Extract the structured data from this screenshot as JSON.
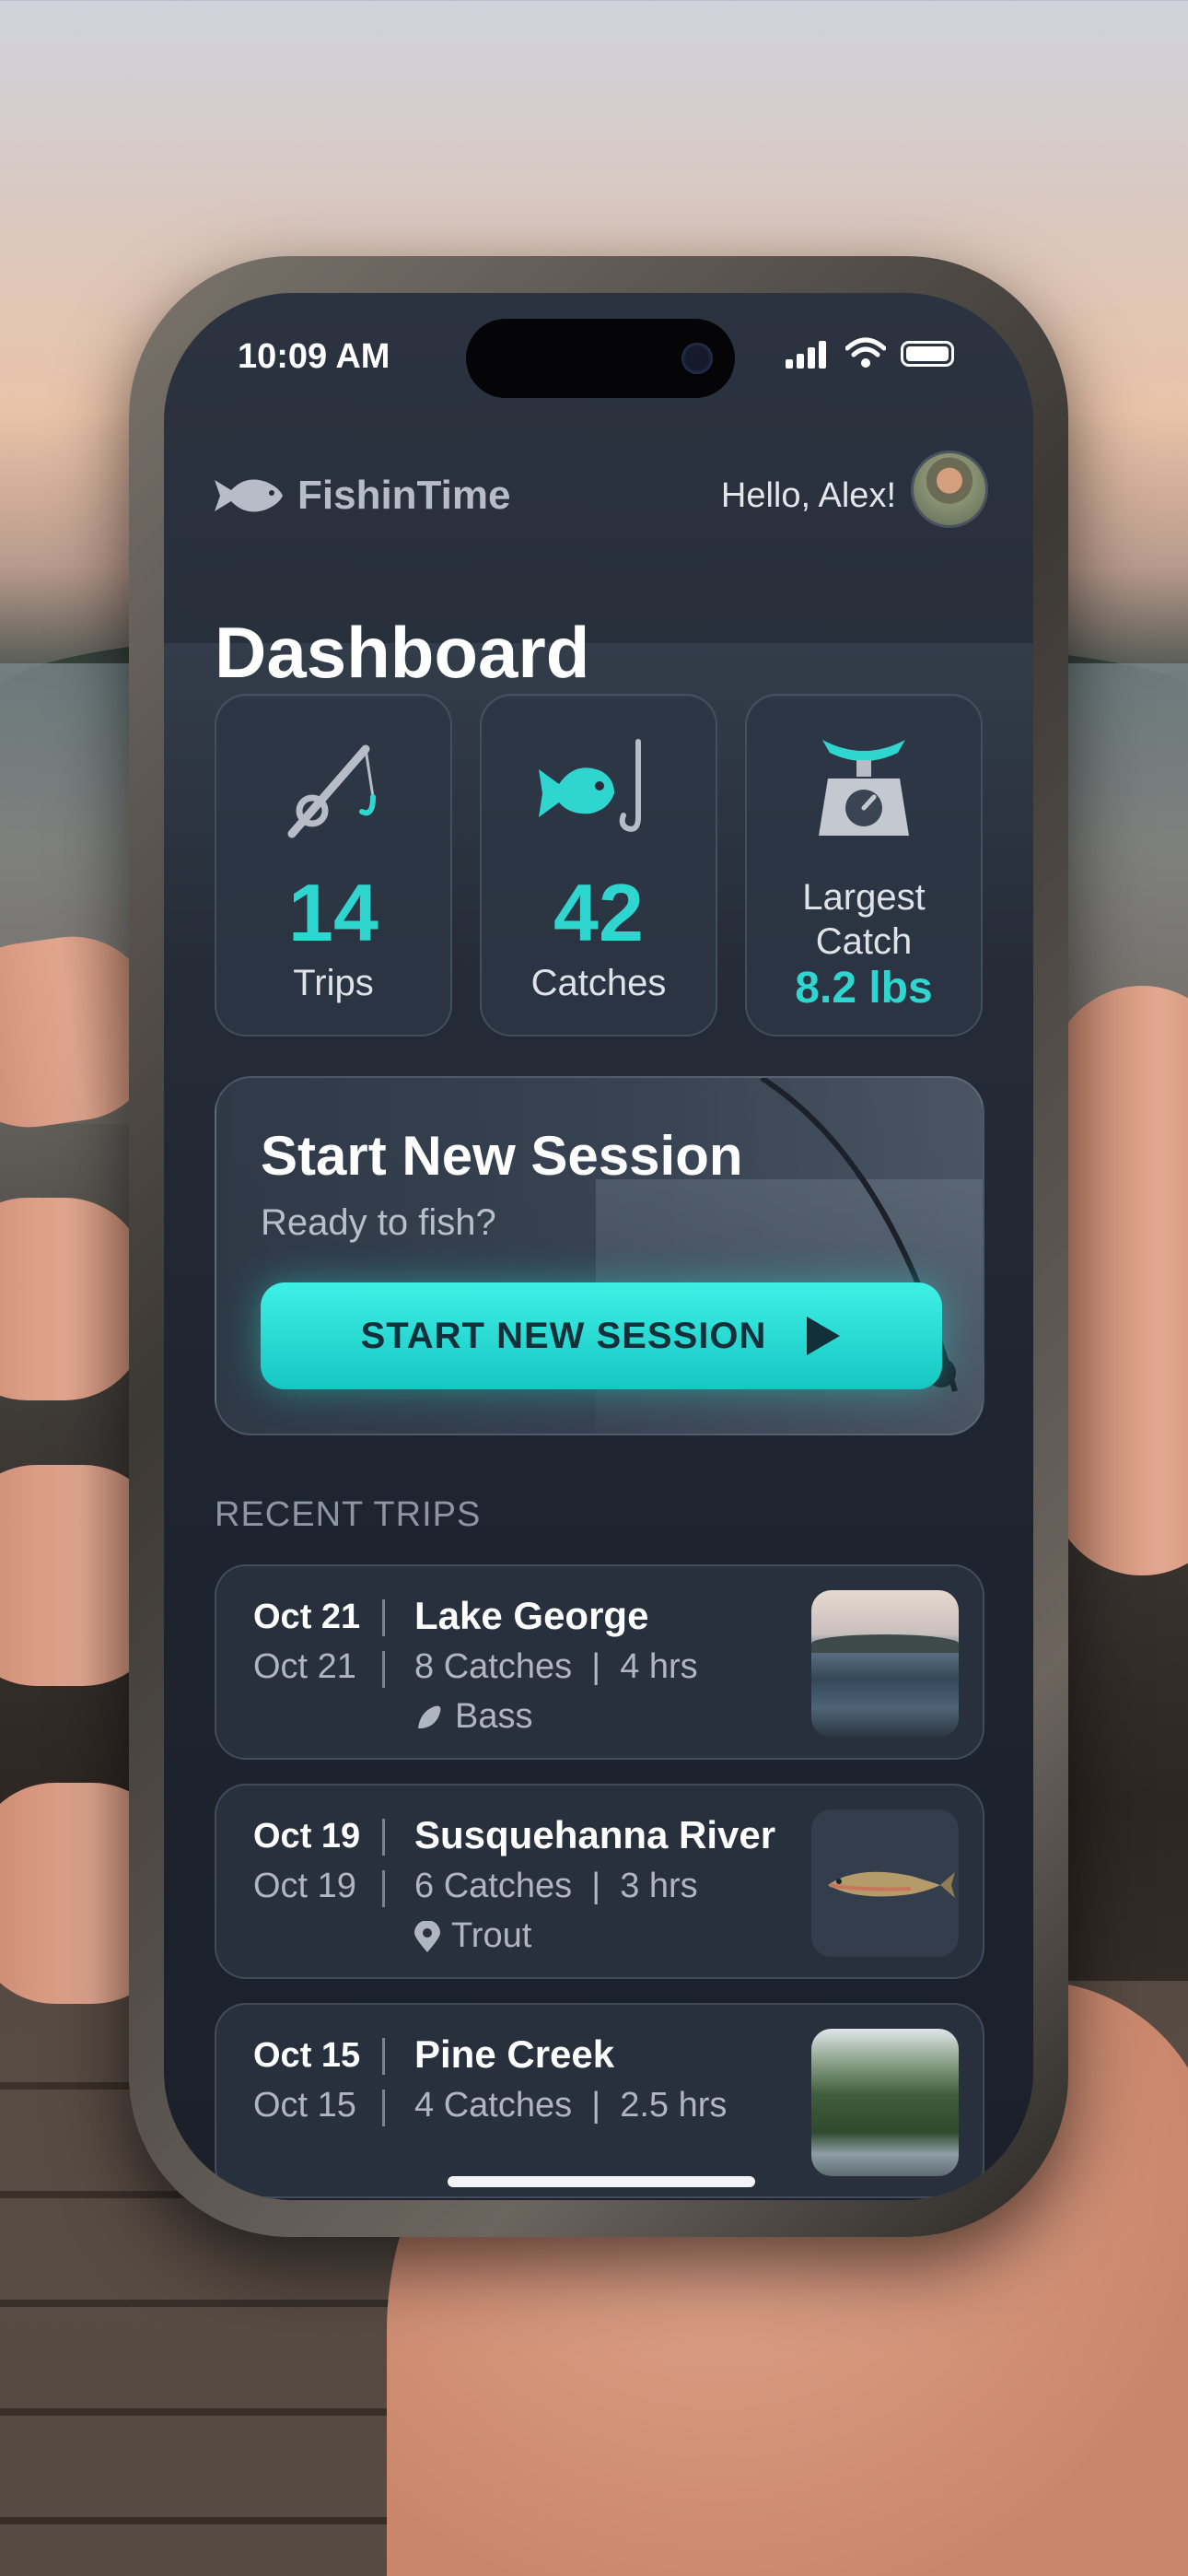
{
  "status_bar": {
    "time": "10:09 AM"
  },
  "header": {
    "app_name": "FishinTime",
    "greeting": "Hello, Alex!"
  },
  "page_title": "Dashboard",
  "stats": [
    {
      "value": "14",
      "label": "Trips",
      "icon": "fishing-rod-icon"
    },
    {
      "value": "42",
      "label": "Catches",
      "icon": "fish-hook-icon"
    },
    {
      "value": "8.2 lbs",
      "label_line1": "Largest",
      "label_line2": "Catch",
      "icon": "scale-icon"
    }
  ],
  "session": {
    "title": "Start New Session",
    "subtitle": "Ready to fish?",
    "button_label": "START NEW SESSION"
  },
  "recent_trips": {
    "section_label": "RECENT TRIPS",
    "items": [
      {
        "date": "Oct 21",
        "date_sub": "Oct 21",
        "location": "Lake George",
        "catches": "8 Catches",
        "duration": "4 hrs",
        "species": "Bass",
        "species_icon": "fish-icon"
      },
      {
        "date": "Oct 19",
        "date_sub": "Oct 19",
        "location": "Susquehanna River",
        "catches": "6 Catches",
        "duration": "3 hrs",
        "species": "Trout",
        "species_icon": "location-pin-icon"
      },
      {
        "date": "Oct 15",
        "date_sub": "Oct 15",
        "location": "Pine Creek",
        "catches": "4 Catches",
        "duration": "2.5 hrs"
      }
    ]
  },
  "colors": {
    "accent": "#2fd5cf",
    "background": "#1f2530",
    "card": "#2d3644"
  }
}
